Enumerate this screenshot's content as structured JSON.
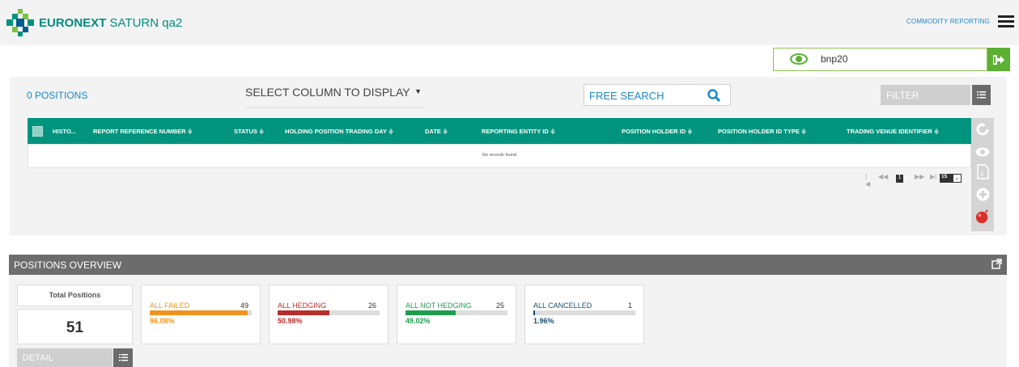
{
  "header": {
    "brand_name": "EURONEXT",
    "brand_env": "SATURN qa2",
    "nav_link": "COMMODITY REPORTING"
  },
  "user": {
    "name": "bnp20"
  },
  "toolbar": {
    "positions_count": "0 POSITIONS",
    "column_select": "SELECT COLUMN TO DISPLAY",
    "free_search_placeholder": "FREE SEARCH",
    "filter_label": "FILTER"
  },
  "grid": {
    "columns": [
      "HISTO...",
      "REPORT REFERENCE NUMBER ≑",
      "STATUS ≑",
      "HOLDING POSITION TRADING DAY ≑",
      "DATE ≑",
      "REPORTING ENTITY ID ≑",
      "POSITION HOLDER ID ≑",
      "POSITION HOLDER ID TYPE ≑",
      "TRADING VENUE IDENTIFIER ≑"
    ],
    "empty_message": "No records found",
    "pager": {
      "current_page": "1",
      "rows_per_page": "15"
    }
  },
  "overview": {
    "title": "POSITIONS OVERVIEW",
    "total_label": "Total Positions",
    "total_value": "51",
    "detail_label": "DETAIL",
    "cards": [
      {
        "label": "ALL FAILED",
        "count": "49",
        "percent_text": "96.08%",
        "fraction": 0.9608,
        "color": "#f0931e"
      },
      {
        "label": "ALL HEDGING",
        "count": "26",
        "percent_text": "50.98%",
        "fraction": 0.5098,
        "color": "#b5302b"
      },
      {
        "label": "ALL NOT HEDGING",
        "count": "25",
        "percent_text": "49.02%",
        "fraction": 0.4902,
        "color": "#1f9d4f"
      },
      {
        "label": "ALL CANCELLED",
        "count": "1",
        "percent_text": "1.96%",
        "fraction": 0.0196,
        "color": "#1b4f6e"
      }
    ]
  },
  "colors": {
    "accent": "#00947f",
    "link": "#1e88c7",
    "success": "#5cb034"
  },
  "icons": [
    "hamburger-icon",
    "eye-icon",
    "logout-icon",
    "search-icon",
    "list-icon",
    "refresh-icon",
    "view-icon",
    "excel-icon",
    "add-icon",
    "bomb-icon",
    "external-link-icon"
  ]
}
